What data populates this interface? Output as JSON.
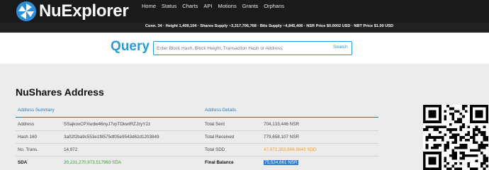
{
  "brand": {
    "name": "NuExplorer"
  },
  "nav": [
    "Home",
    "Status",
    "Charts",
    "API",
    "Motions",
    "Grants",
    "Orphans"
  ],
  "stats": "Conn. 34 · Height 1,409,104 · Shares Supply ~3,317,706,768 · Bits Supply ~4,845,406 · NSR Price $0.0002 USD · NBT Price $1.00 USD",
  "search": {
    "label": "Query",
    "placeholder": "Enter Block Hash, Block Height, Transaction Hash or Address",
    "button": "Search"
  },
  "page_title": "NuShares Address",
  "summary_header": "Address Summary",
  "details_header": "Address Details",
  "rows": [
    {
      "k1": "Address",
      "v1": "SSajkovCPXwdw46nyJ7vpTDkwtRZJzyY2z",
      "k2": "Total Sent",
      "v2": "704,133,446 NSR"
    },
    {
      "k1": "Hash 160",
      "v1": "3a02f2ba9c553e1f8575df05e9543d62d1203849",
      "k2": "Total Received",
      "v2": "779,658,107 NSR"
    },
    {
      "k1": "No. Trans.",
      "v1": "14,972",
      "k2": "Total SDD",
      "v2": "47,872,353,866.8843 SDD"
    },
    {
      "k1": "SDA",
      "v1": "20,231,270,973.517963 SDA",
      "k2": "Final Balance",
      "v2": "75,524,661 NSR"
    }
  ],
  "colors": {
    "accent": "#2a9ad8",
    "green": "#3a9a3a",
    "orange": "#f0a030",
    "selection": "#2a7ad8"
  },
  "qr_icon": "qr-code-icon"
}
